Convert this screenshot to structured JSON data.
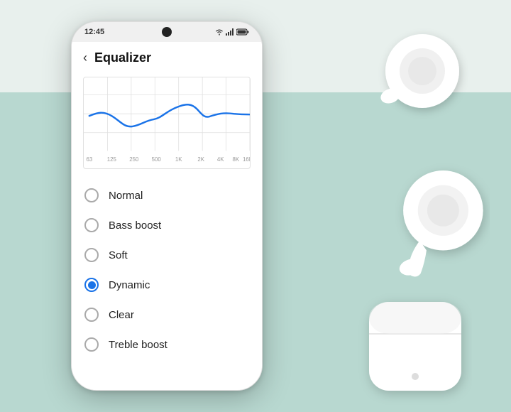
{
  "scene": {
    "bg_colors": {
      "top": "#e8f0ed",
      "bottom": "#b8d8d0"
    }
  },
  "phone": {
    "status_bar": {
      "time": "12:45",
      "battery": "100%",
      "signal": "WiFi+4G"
    },
    "header": {
      "back_label": "<",
      "title": "Equalizer"
    },
    "eq_options": [
      {
        "id": "normal",
        "label": "Normal",
        "selected": false
      },
      {
        "id": "bass-boost",
        "label": "Bass boost",
        "selected": false
      },
      {
        "id": "soft",
        "label": "Soft",
        "selected": false
      },
      {
        "id": "dynamic",
        "label": "Dynamic",
        "selected": true
      },
      {
        "id": "clear",
        "label": "Clear",
        "selected": false
      },
      {
        "id": "treble-boost",
        "label": "Treble boost",
        "selected": false
      }
    ]
  }
}
